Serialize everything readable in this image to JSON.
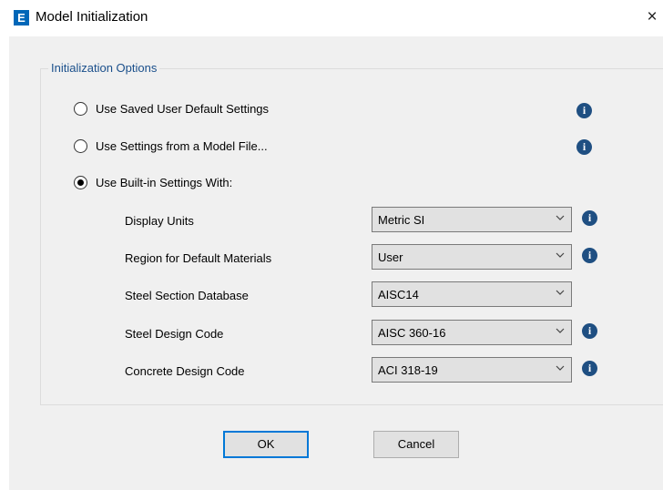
{
  "window": {
    "title": "Model Initialization",
    "app_icon_letter": "E",
    "close_glyph": "×"
  },
  "group": {
    "legend": "Initialization Options"
  },
  "options": [
    {
      "label": "Use Saved User Default Settings",
      "selected": false
    },
    {
      "label": "Use Settings from a Model File...",
      "selected": false
    },
    {
      "label": "Use Built-in Settings With:",
      "selected": true
    }
  ],
  "settings": [
    {
      "label": "Display Units",
      "value": "Metric SI"
    },
    {
      "label": "Region for Default Materials",
      "value": "User"
    },
    {
      "label": "Steel Section Database",
      "value": "AISC14"
    },
    {
      "label": "Steel Design Code",
      "value": "AISC 360-16"
    },
    {
      "label": "Concrete Design Code",
      "value": "ACI 318-19"
    }
  ],
  "info_glyph": "i",
  "buttons": {
    "ok": "OK",
    "cancel": "Cancel"
  },
  "colors": {
    "accent": "#0067b8",
    "info": "#1f4f82",
    "legend": "#1a4f8b",
    "dialog_bg": "#f0f0f0"
  }
}
